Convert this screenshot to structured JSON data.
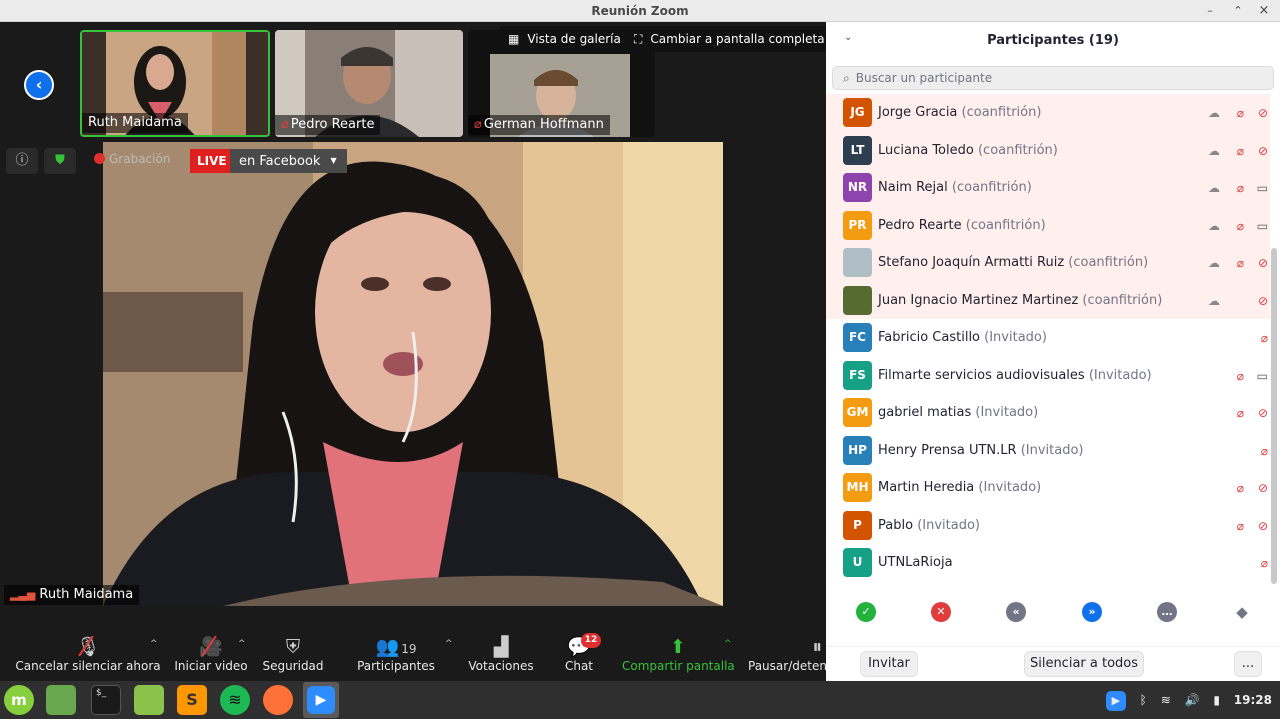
{
  "window": {
    "title": "Reunión Zoom"
  },
  "topbar": {
    "gallery_view_label": "Vista de galería",
    "fullscreen_label": "Cambiar a pantalla completa"
  },
  "thumbnails": [
    {
      "name": "Ruth Maidama",
      "muted": false,
      "active_speaker": true
    },
    {
      "name": "Pedro Rearte",
      "muted": true,
      "active_speaker": false
    },
    {
      "name": "German Hoffmann",
      "muted": true,
      "active_speaker": false
    }
  ],
  "status": {
    "recording_label": "Grabación",
    "live_badge": "LIVE",
    "live_target": "en Facebook"
  },
  "main_video": {
    "speaker_name": "Ruth Maidama"
  },
  "toolbar": {
    "unmute_label": "Cancelar silenciar ahora",
    "video_label": "Iniciar video",
    "security_label": "Seguridad",
    "participants_label": "Participantes",
    "participants_count": "19",
    "polls_label": "Votaciones",
    "chat_label": "Chat",
    "chat_badge": "12",
    "share_label": "Compartir pantalla",
    "pause_label": "Pausar/detener"
  },
  "panel": {
    "title": "Participantes (19)",
    "search_placeholder": "Buscar un participante",
    "participants": [
      {
        "initials": "JG",
        "name": "Jorge Gracia",
        "role": "(coanfitrión)",
        "color": "#d35400",
        "cohost": true,
        "cloud": true,
        "mic_muted": true,
        "cam_off": true
      },
      {
        "initials": "LT",
        "name": "Luciana Toledo",
        "role": "(coanfitrión)",
        "color": "#2c3e50",
        "cohost": true,
        "cloud": true,
        "mic_muted": true,
        "cam_off": true
      },
      {
        "initials": "NR",
        "name": "Naim Rejal",
        "role": "(coanfitrión)",
        "color": "#8e44ad",
        "cohost": true,
        "cloud": true,
        "mic_muted": true,
        "cam_off": false
      },
      {
        "initials": "PR",
        "name": "Pedro Rearte",
        "role": "(coanfitrión)",
        "color": "#f39c12",
        "cohost": true,
        "cloud": true,
        "mic_muted": true,
        "cam_off": false
      },
      {
        "initials": "",
        "name": "Stefano Joaquín Armatti Ruiz",
        "role": "(coanfitrión)",
        "color": "#b0bec5",
        "cohost": true,
        "cloud": true,
        "mic_muted": true,
        "cam_off": true,
        "photo": true
      },
      {
        "initials": "",
        "name": "Juan Ignacio Martinez Martinez",
        "role": "(coanfitrión)",
        "color": "#556b2f",
        "cohost": true,
        "cloud": true,
        "mic_muted": false,
        "cam_off": true,
        "photo": true
      },
      {
        "initials": "FC",
        "name": "Fabricio Castillo",
        "role": "(Invitado)",
        "color": "#2980b9",
        "cohost": false,
        "cloud": false,
        "mic_muted": true,
        "cam_off": false,
        "no_cam": true
      },
      {
        "initials": "FS",
        "name": "Filmarte servicios audiovisuales",
        "role": "(Invitado)",
        "color": "#16a085",
        "cohost": false,
        "cloud": false,
        "mic_muted": true,
        "cam_off": false
      },
      {
        "initials": "GM",
        "name": "gabriel matias",
        "role": "(Invitado)",
        "color": "#f39c12",
        "cohost": false,
        "cloud": false,
        "mic_muted": true,
        "cam_off": true
      },
      {
        "initials": "HP",
        "name": "Henry Prensa UTN.LR",
        "role": "(Invitado)",
        "color": "#2980b9",
        "cohost": false,
        "cloud": false,
        "mic_muted": true,
        "cam_off": false,
        "no_cam": true
      },
      {
        "initials": "MH",
        "name": "Martin Heredia",
        "role": "(Invitado)",
        "color": "#f39c12",
        "cohost": false,
        "cloud": false,
        "mic_muted": true,
        "cam_off": true
      },
      {
        "initials": "P",
        "name": "Pablo",
        "role": "(Invitado)",
        "color": "#d35400",
        "cohost": false,
        "cloud": false,
        "mic_muted": true,
        "cam_off": true
      },
      {
        "initials": "U",
        "name": "UTNLaRioja",
        "role": "",
        "color": "#16a085",
        "cohost": false,
        "cloud": false,
        "mic_muted": true,
        "cam_off": false,
        "no_cam": true
      }
    ],
    "invite_label": "Invitar",
    "mute_all_label": "Silenciar a todos",
    "more_label": "..."
  },
  "tray": {
    "time": "19:28"
  }
}
